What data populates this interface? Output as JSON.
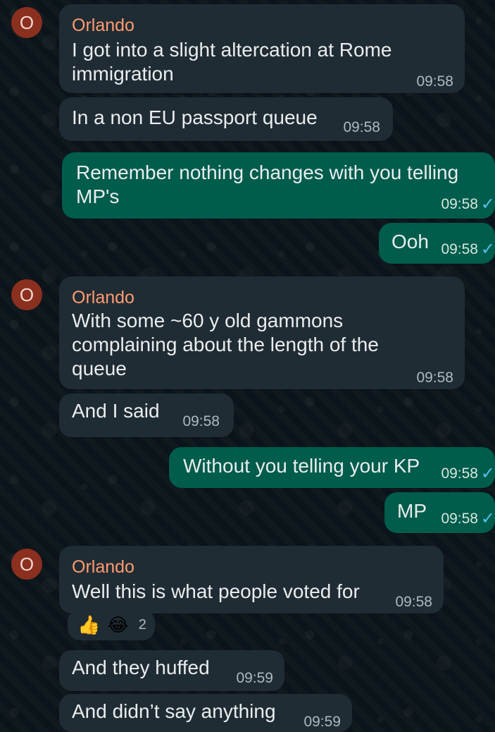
{
  "chat": {
    "sender_name": "Orlando",
    "avatar_initial": "O",
    "messages": [
      {
        "direction": "incoming",
        "sender": "Orlando",
        "lines": [
          "I got into a slight altercation at Rome",
          "immigration"
        ],
        "time": "09:58"
      },
      {
        "direction": "incoming",
        "lines": [
          "In a non EU passport queue"
        ],
        "time": "09:58"
      },
      {
        "direction": "outgoing",
        "lines": [
          "Remember nothing changes with you telling",
          "MP's"
        ],
        "time": "09:58"
      },
      {
        "direction": "outgoing",
        "lines": [
          "Ooh"
        ],
        "time": "09:58"
      },
      {
        "direction": "incoming",
        "sender": "Orlando",
        "lines": [
          "With some ~60 y old gammons",
          "complaining about the length of the",
          "queue"
        ],
        "time": "09:58"
      },
      {
        "direction": "incoming",
        "lines": [
          "And I said"
        ],
        "time": "09:58"
      },
      {
        "direction": "outgoing",
        "lines": [
          "Without you telling your KP"
        ],
        "time": "09:58"
      },
      {
        "direction": "outgoing",
        "lines": [
          "MP"
        ],
        "time": "09:58"
      },
      {
        "direction": "incoming",
        "sender": "Orlando",
        "lines": [
          "Well this is what people voted for"
        ],
        "time": "09:58"
      },
      {
        "direction": "incoming",
        "lines": [
          "And they huffed"
        ],
        "time": "09:59"
      },
      {
        "direction": "incoming",
        "lines": [
          "And didn’t say anything"
        ],
        "time": "09:59"
      }
    ],
    "reactions": {
      "emoji_1": "👍",
      "emoji_2": "😂",
      "count": "2"
    }
  },
  "colors": {
    "background": "#0b141a",
    "incoming": "#202c33",
    "outgoing": "#005c4b",
    "sender_name": "#ff9b72",
    "tick": "#53bdeb"
  },
  "icons": {
    "tick": "double-check-icon",
    "avatar": "avatar"
  }
}
